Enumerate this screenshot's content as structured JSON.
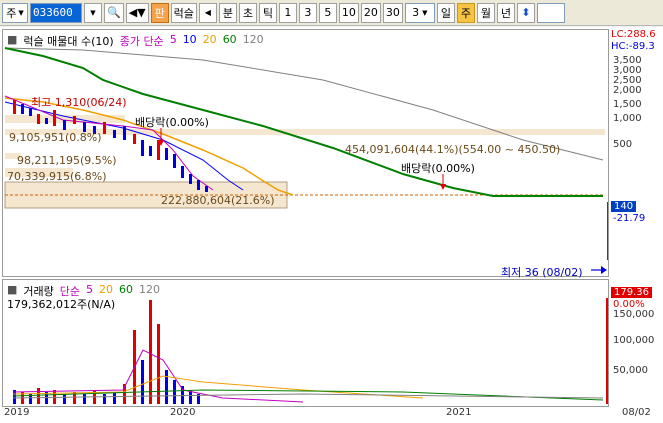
{
  "toolbar": {
    "market_select": "주",
    "stock_code": "033600",
    "btn_chart": "판",
    "btn_luck": "럭슬",
    "btn_min": "분",
    "btn_tick": "초",
    "btn_tick2": "틱",
    "periods": [
      "1",
      "3",
      "5",
      "10",
      "20",
      "30"
    ],
    "count_value": "3",
    "btn_day": "일",
    "btn_week": "주",
    "btn_month": "월",
    "btn_year": "년"
  },
  "price_panel": {
    "legend": {
      "title": "럭슬 매물대 수(10)",
      "indicator": "종가 단순",
      "ma5": "5",
      "ma10": "10",
      "ma20": "20",
      "ma60": "60",
      "ma120": "120"
    },
    "lc": "LC:288.6",
    "hc": "HC:-89.3",
    "y_ticks": [
      "3,500",
      "3,000",
      "2,500",
      "2,000",
      "1,500",
      "1,000",
      "500"
    ],
    "current_price": "140",
    "current_change": "-21.79",
    "high_label": "최고 1,310(06/24)",
    "dividend_1": "배당락(0.00%)",
    "dividend_2": "배당락(0.00%)",
    "vol_box_1": "9,105,951(0.8%)",
    "vol_box_2": "98,211,195(9.5%)",
    "vol_box_3": "70,339,915(6.8%)",
    "vol_box_4": "222,880,604(21.6%)",
    "vol_box_5": "454,091,604(44.1%)(554.00 ~ 450.50)",
    "low_label": "최저 36 (08/02)"
  },
  "volume_panel": {
    "legend": {
      "title": "거래량",
      "indicator": "단순",
      "ma5": "5",
      "ma20": "20",
      "ma60": "60",
      "ma120": "120"
    },
    "value_text": "179,362,012주(N/A)",
    "y_ticks": [
      "150,000",
      "100,000",
      "50,000"
    ],
    "current_volume": "179.36",
    "current_pct": "0.00%"
  },
  "xaxis": {
    "labels": [
      "2019",
      "2020",
      "2021",
      "08/02"
    ]
  },
  "colors": {
    "ma5": "#c000c0",
    "ma10": "#0000ff",
    "ma20": "#f0a000",
    "ma60": "#008000",
    "ma120": "#808080",
    "up": "#e00000",
    "down": "#0000e0",
    "volbox": "#f5e6d0"
  }
}
